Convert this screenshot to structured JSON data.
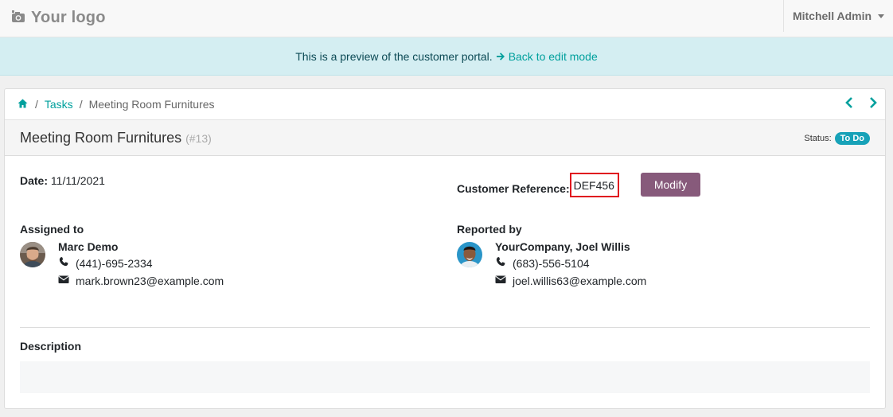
{
  "navbar": {
    "logo_text": "Your logo",
    "user_name": "Mitchell Admin"
  },
  "banner": {
    "text": "This is a preview of the customer portal.",
    "link_label": "Back to edit mode"
  },
  "breadcrumb": {
    "separator": "/",
    "items": [
      "Tasks",
      "Meeting Room Furnitures"
    ]
  },
  "pager": {
    "prev": "‹",
    "next": "›"
  },
  "task": {
    "title": "Meeting Room Furnitures",
    "id": "(#13)",
    "status_label": "Status:",
    "status_value": "To Do"
  },
  "details": {
    "date_label": "Date:",
    "date_value": "11/11/2021",
    "customer_ref_label": "Customer Reference:",
    "customer_ref_value": "DEF456",
    "modify_label": "Modify"
  },
  "assigned": {
    "title": "Assigned to",
    "name": "Marc Demo",
    "phone": "(441)-695-2334",
    "email": "mark.brown23@example.com"
  },
  "reported": {
    "title": "Reported by",
    "name": "YourCompany, Joel Willis",
    "phone": "(683)-556-5104",
    "email": "joel.willis63@example.com"
  },
  "description": {
    "label": "Description"
  },
  "colors": {
    "accent": "#00a09d",
    "primary_button": "#875a7b",
    "badge": "#17a2b8",
    "highlight_box": "#e0101e",
    "banner_bg": "#d4eef2"
  }
}
